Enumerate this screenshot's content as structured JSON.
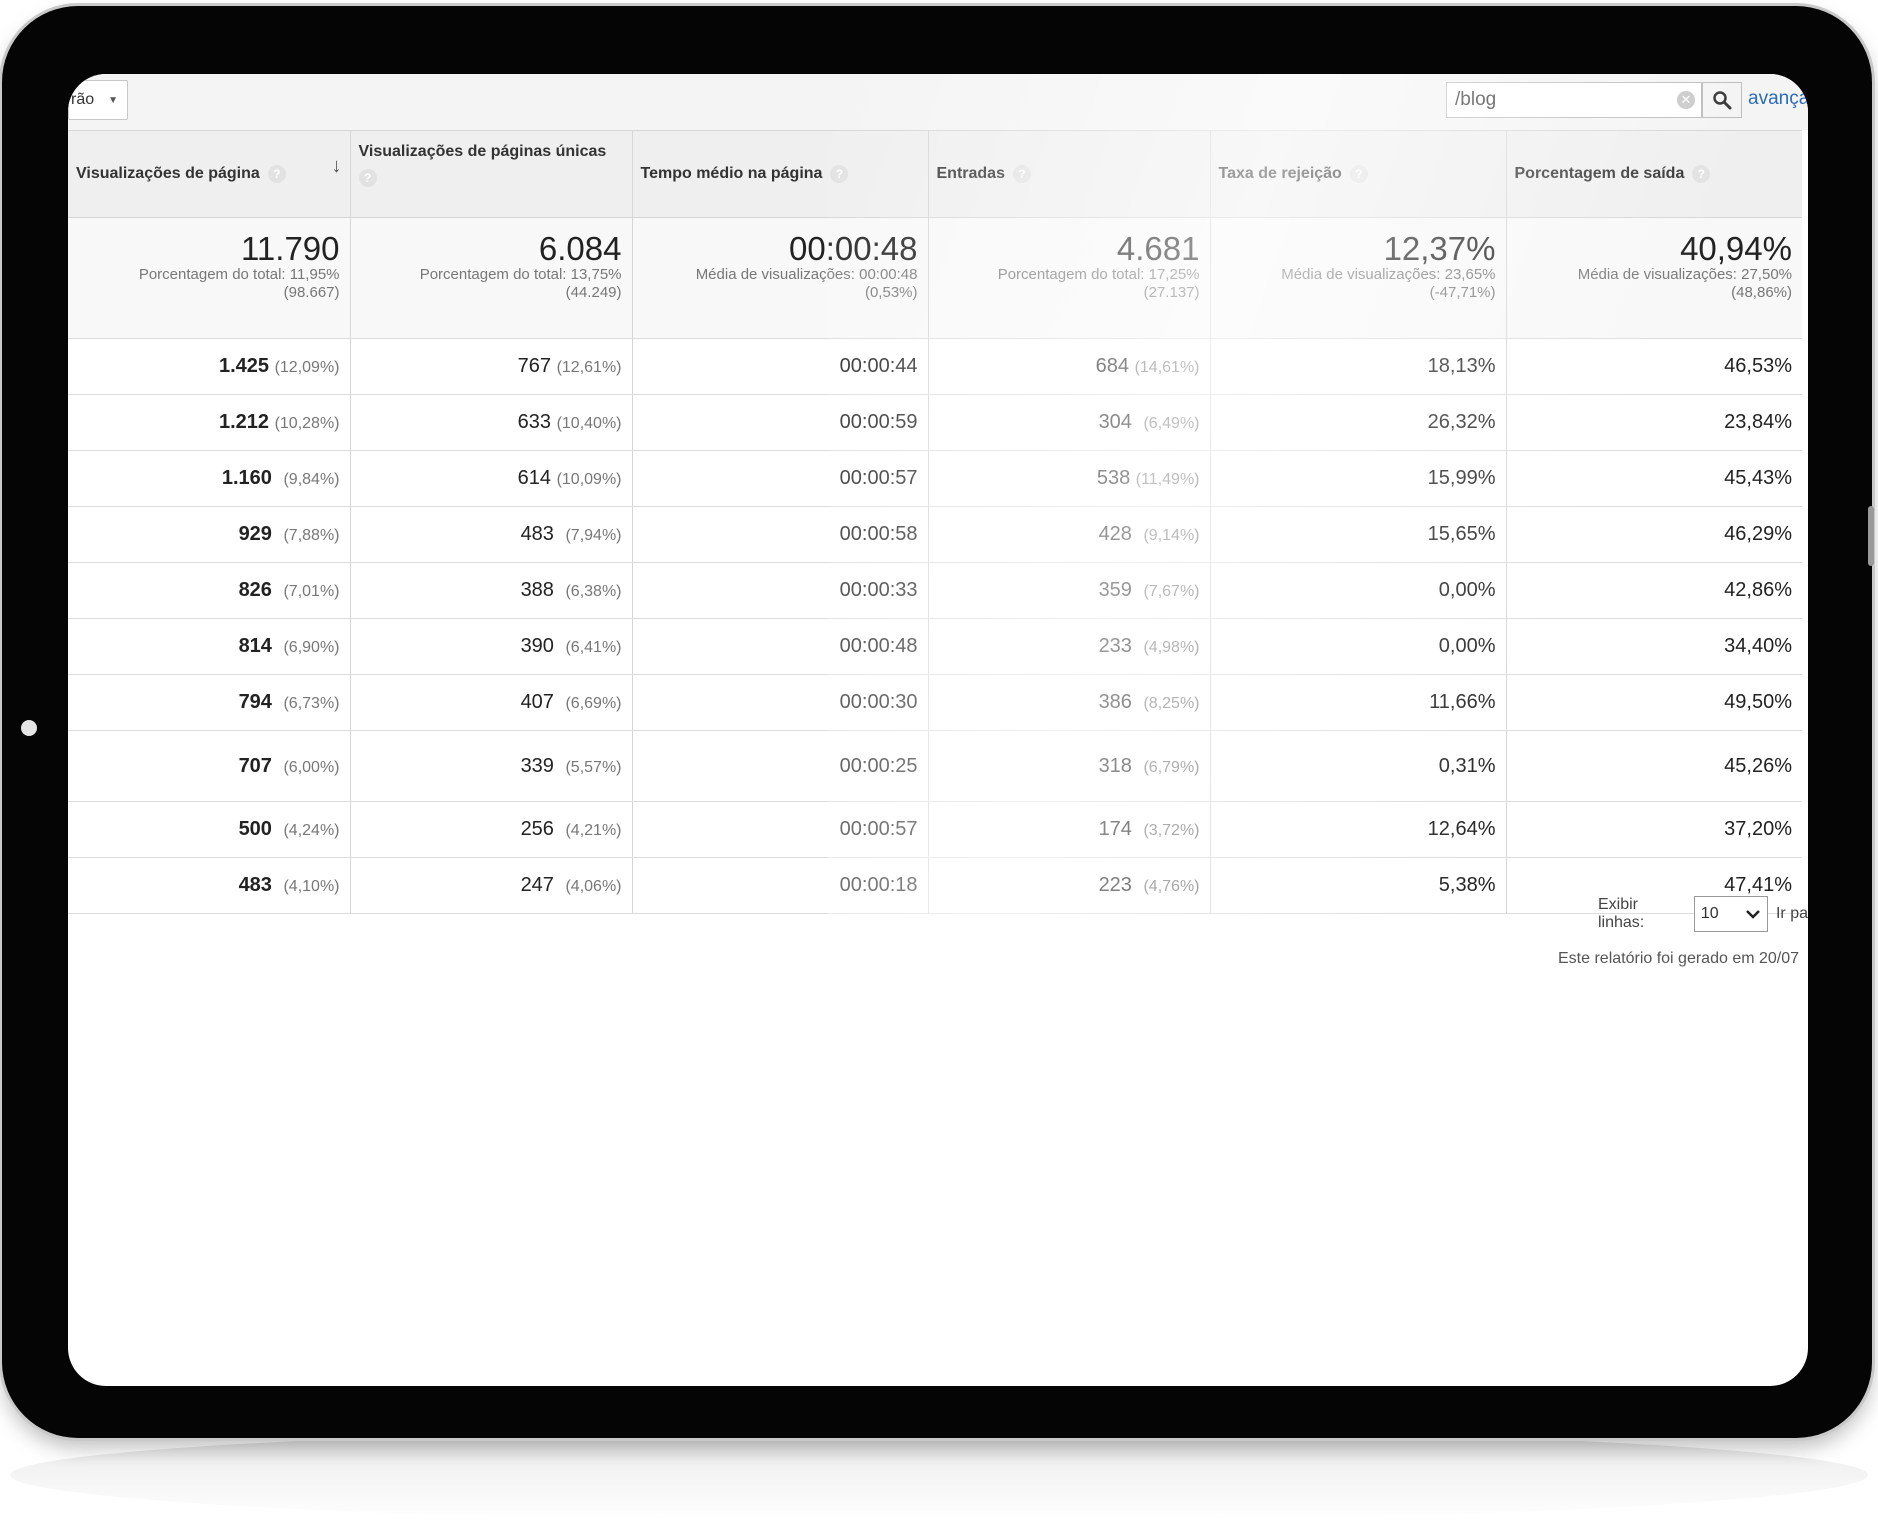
{
  "toolbar": {
    "dropdown_label": "rão",
    "search_value": "/blog",
    "advanced_link": "avança"
  },
  "columns": [
    {
      "label": "Visualizações de página",
      "sorted": true
    },
    {
      "label": "Visualizações de páginas únicas"
    },
    {
      "label": "Tempo médio na página"
    },
    {
      "label": "Entradas"
    },
    {
      "label": "Taxa de rejeição"
    },
    {
      "label": "Porcentagem de saída"
    }
  ],
  "summary": [
    {
      "value": "11.790",
      "line1": "Porcentagem do total: 11,95%",
      "line2": "(98.667)"
    },
    {
      "value": "6.084",
      "line1": "Porcentagem do total: 13,75%",
      "line2": "(44.249)"
    },
    {
      "value": "00:00:48",
      "line1": "Média de visualizações: 00:00:48",
      "line2": "(0,53%)"
    },
    {
      "value": "4.681",
      "line1": "Porcentagem do total: 17,25%",
      "line2": "(27.137)"
    },
    {
      "value": "12,37%",
      "line1": "Média de visualizações: 23,65%",
      "line2": "(-47,71%)"
    },
    {
      "value": "40,94%",
      "line1": "Média de visualizações: 27,50%",
      "line2": "(48,86%)"
    }
  ],
  "rows": [
    {
      "pv": "1.425",
      "pv_pct": "(12,09%)",
      "upv": "767",
      "upv_pct": "(12,61%)",
      "time": "00:00:44",
      "ent": "684",
      "ent_pct": "(14,61%)",
      "bounce": "18,13%",
      "exit": "46,53%"
    },
    {
      "pv": "1.212",
      "pv_pct": "(10,28%)",
      "upv": "633",
      "upv_pct": "(10,40%)",
      "time": "00:00:59",
      "ent": "304",
      "ent_pct": "(6,49%)",
      "bounce": "26,32%",
      "exit": "23,84%"
    },
    {
      "pv": "1.160",
      "pv_pct": "(9,84%)",
      "upv": "614",
      "upv_pct": "(10,09%)",
      "time": "00:00:57",
      "ent": "538",
      "ent_pct": "(11,49%)",
      "bounce": "15,99%",
      "exit": "45,43%"
    },
    {
      "pv": "929",
      "pv_pct": "(7,88%)",
      "upv": "483",
      "upv_pct": "(7,94%)",
      "time": "00:00:58",
      "ent": "428",
      "ent_pct": "(9,14%)",
      "bounce": "15,65%",
      "exit": "46,29%"
    },
    {
      "pv": "826",
      "pv_pct": "(7,01%)",
      "upv": "388",
      "upv_pct": "(6,38%)",
      "time": "00:00:33",
      "ent": "359",
      "ent_pct": "(7,67%)",
      "bounce": "0,00%",
      "exit": "42,86%"
    },
    {
      "pv": "814",
      "pv_pct": "(6,90%)",
      "upv": "390",
      "upv_pct": "(6,41%)",
      "time": "00:00:48",
      "ent": "233",
      "ent_pct": "(4,98%)",
      "bounce": "0,00%",
      "exit": "34,40%"
    },
    {
      "pv": "794",
      "pv_pct": "(6,73%)",
      "upv": "407",
      "upv_pct": "(6,69%)",
      "time": "00:00:30",
      "ent": "386",
      "ent_pct": "(8,25%)",
      "bounce": "11,66%",
      "exit": "49,50%"
    },
    {
      "pv": "707",
      "pv_pct": "(6,00%)",
      "upv": "339",
      "upv_pct": "(5,57%)",
      "time": "00:00:25",
      "ent": "318",
      "ent_pct": "(6,79%)",
      "bounce": "0,31%",
      "exit": "45,26%"
    },
    {
      "pv": "500",
      "pv_pct": "(4,24%)",
      "upv": "256",
      "upv_pct": "(4,21%)",
      "time": "00:00:57",
      "ent": "174",
      "ent_pct": "(3,72%)",
      "bounce": "12,64%",
      "exit": "37,20%"
    },
    {
      "pv": "483",
      "pv_pct": "(4,10%)",
      "upv": "247",
      "upv_pct": "(4,06%)",
      "time": "00:00:18",
      "ent": "223",
      "ent_pct": "(4,76%)",
      "bounce": "5,38%",
      "exit": "47,41%"
    }
  ],
  "footer": {
    "rows_label": "Exibir linhas:",
    "rows_value": "10",
    "goto_label": "Ir pa",
    "report_note": "Este relatório foi gerado em 20/07"
  }
}
